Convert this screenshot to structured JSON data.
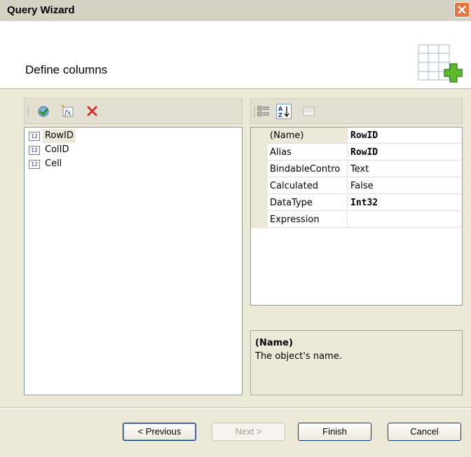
{
  "window": {
    "title": "Query Wizard"
  },
  "header": {
    "heading": "Define columns"
  },
  "columns": [
    {
      "type_badge": "12",
      "name": "RowID",
      "selected": true
    },
    {
      "type_badge": "12",
      "name": "ColID",
      "selected": false
    },
    {
      "type_badge": "12",
      "name": "Cell",
      "selected": false
    }
  ],
  "properties": [
    {
      "name": "(Name)",
      "value": "RowID",
      "bold": true
    },
    {
      "name": "Alias",
      "value": "RowID",
      "bold": true
    },
    {
      "name": "BindableContro",
      "value": "Text",
      "bold": false
    },
    {
      "name": "Calculated",
      "value": "False",
      "bold": false
    },
    {
      "name": "DataType",
      "value": "Int32",
      "bold": true
    },
    {
      "name": "Expression",
      "value": "",
      "bold": false
    }
  ],
  "description": {
    "title": "(Name)",
    "text": "The object's name."
  },
  "buttons": {
    "previous": "< Previous",
    "next": "Next >",
    "finish": "Finish",
    "cancel": "Cancel"
  },
  "colors": {
    "accent": "#003c74",
    "close": "#e8733d",
    "delete": "#e0201b"
  }
}
